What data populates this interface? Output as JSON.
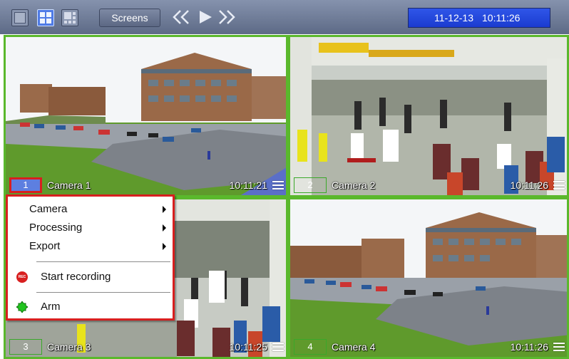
{
  "toolbar": {
    "screens_label": "Screens",
    "date": "11-12-13",
    "time": "10:11:26",
    "layout_icons": [
      "single-view-icon",
      "quad-view-icon",
      "multi-view-icon"
    ],
    "nav_icons": [
      "rewind-icon",
      "play-icon",
      "fast-forward-icon"
    ],
    "active_layout": "quad"
  },
  "cameras": [
    {
      "number": "1",
      "label": "Camera 1",
      "time": "10:11:21",
      "selected": true
    },
    {
      "number": "2",
      "label": "Camera 2",
      "time": "10:11:26",
      "selected": false
    },
    {
      "number": "3",
      "label": "Camera 3",
      "time": "10:11:25",
      "selected": false
    },
    {
      "number": "4",
      "label": "Camera 4",
      "time": "10:11:26",
      "selected": false
    }
  ],
  "context_menu": {
    "submenus": [
      "Camera",
      "Processing",
      "Export"
    ],
    "start_recording": "Start recording",
    "arm": "Arm",
    "rec_icon_text": "REC"
  },
  "colors": {
    "toolbar": "#6f7b98",
    "datetime_bg": "#2446de",
    "camera_border": "#5ab82c",
    "selected_border": "#d81f1f",
    "arm_icon": "#22c51f"
  }
}
